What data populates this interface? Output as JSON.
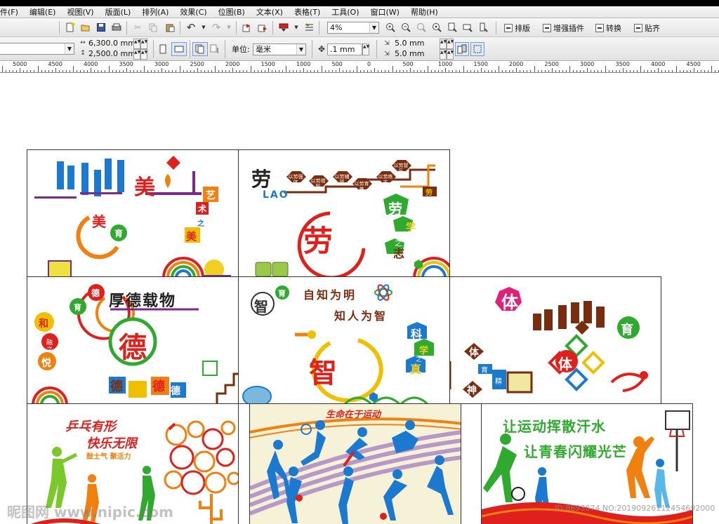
{
  "menu": [
    "件(F)",
    "编辑(E)",
    "视图(V)",
    "版面(L)",
    "排列(A)",
    "效果(C)",
    "位图(B)",
    "文本(X)",
    "表格(T)",
    "工具(O)",
    "窗口(W)",
    "帮助(H)"
  ],
  "toolbar": {
    "zoom_value": "4%",
    "plugins": [
      "排版",
      "增强插件",
      "转换",
      "贴齐"
    ]
  },
  "property_bar": {
    "page_size_value": "",
    "width": "6,300.0 mm",
    "height": "2,500.0 mm",
    "units_label": "单位:",
    "units_value": "毫米",
    "nudge": ".1 mm",
    "dup_x": "5.0 mm",
    "dup_y": "5.0 mm"
  },
  "ruler_labels": [
    "5000",
    "4500",
    "4000",
    "3500",
    "3000",
    "2500",
    "2000",
    "1500",
    "1000",
    "500",
    "0",
    "500",
    "1000",
    "1500",
    "2000",
    "2500",
    "3000",
    "3500",
    "4000",
    "4500"
  ],
  "panels": {
    "mei": {
      "big": "美",
      "small1": "美",
      "small2": "育",
      "art": [
        "艺",
        "术",
        "之",
        "美"
      ]
    },
    "lao": {
      "title": "劳",
      "title_en": "LAO",
      "tags": [
        "以劳强体",
        "以劳增智",
        "以劳辅德",
        "以劳育美",
        "以劳练志",
        "以劳冒乐"
      ],
      "center": "劳",
      "side": [
        "劳",
        "学",
        "之",
        "志"
      ],
      "corner": "劳"
    },
    "de": {
      "heading": "厚德载物",
      "top_badge": "德",
      "top_badge2": "育",
      "center": "德",
      "side": [
        "和",
        "融",
        "之",
        "悦"
      ],
      "bottom": [
        "德",
        "德",
        "德"
      ]
    },
    "zhi": {
      "slogan1": "自知为明",
      "slogan2": "知人为智",
      "badge": "智",
      "badge2": "育",
      "center": "智",
      "side": [
        "科",
        "学",
        "之",
        "真"
      ]
    },
    "ti": {
      "big": "体",
      "center": "体",
      "badge": "育",
      "side": [
        "体",
        "育",
        "精",
        "神"
      ]
    },
    "pingpong": {
      "line1": "乒乓有形",
      "line2": "快乐无限",
      "line3": "鼓士气 聚活力"
    },
    "run": {
      "banner": "生命在于运动"
    },
    "sweat": {
      "line1": "让运动挥散汗水",
      "line2": "让青春闪耀光芒"
    }
  },
  "watermark": {
    "left": "昵图网 www.nipic.com",
    "right": "ID:8693874 NO:20190926112454692000"
  },
  "colors": {
    "orange": "#f08010",
    "red": "#e0201c",
    "green": "#2faa2f",
    "blue": "#1b7ad0",
    "purple": "#7a2a8a",
    "brown": "#7a2d0e",
    "darkred": "#a01818"
  }
}
